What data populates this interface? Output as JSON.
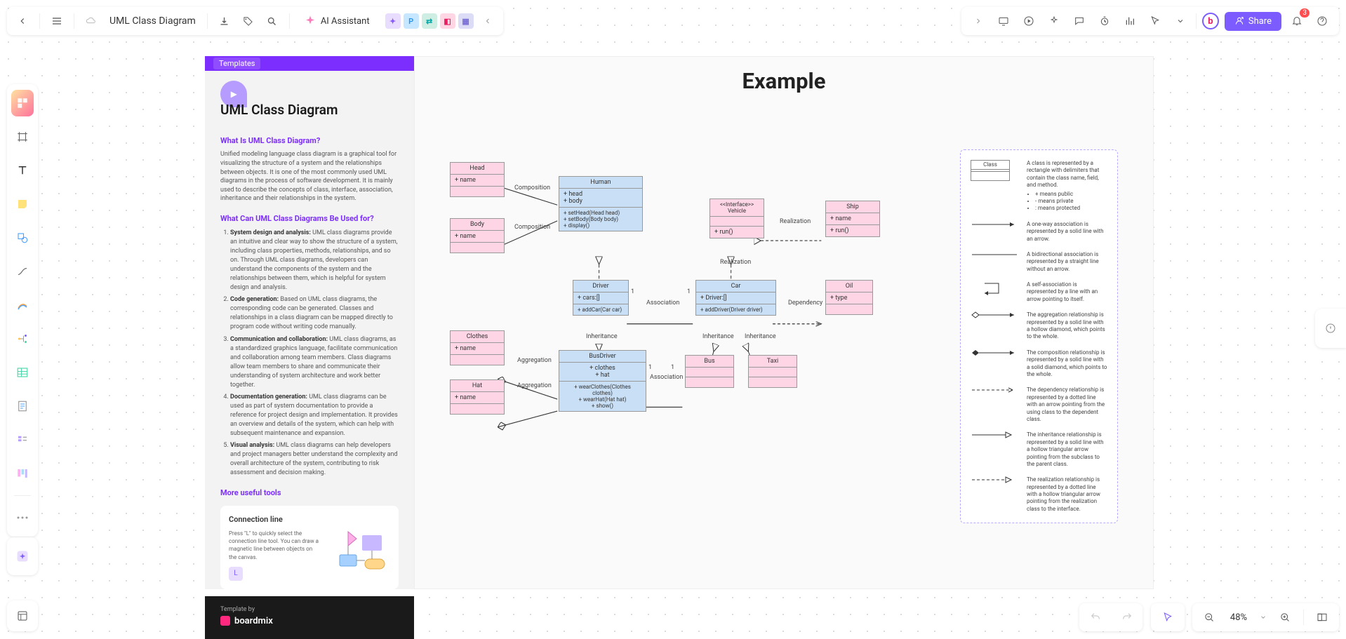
{
  "doc_title": "UML Class Diagram",
  "ai_label": "AI Assistant",
  "share_label": "Share",
  "notif_count": "3",
  "zoom": "48%",
  "templates_tab": "Templates",
  "panel": {
    "title": "UML Class Diagram",
    "q1": "What Is UML Class Diagram?",
    "p1": "Unified modeling language class diagram is a graphical tool for visualizing the structure of a system and the relationships between objects. It is one of the most commonly used UML diagrams in the process of software development. It is mainly used to describe the concepts of class, interface, association, inheritance and their relationships in the system.",
    "q2": "What Can UML Class Diagrams Be Used for?",
    "li1b": "System design and analysis:",
    "li1": " UML class diagrams provide an intuitive and clear way to show the structure of a system, including class properties, methods, relationships, and so on. Through UML class diagrams, developers can understand the components of the system and the relationships between them, which is helpful for system design and analysis.",
    "li2b": "Code generation:",
    "li2": " Based on UML class diagrams, the corresponding code can be generated. Classes and relationships in a class diagram can be mapped directly to program code without writing code manually.",
    "li3b": "Communication and collaboration:",
    "li3": " UML class diagrams, as a standardized graphics language, facilitate communication and collaboration among team members. Class diagrams allow team members to share and communicate their understanding of system architecture and work better together.",
    "li4b": "Documentation generation:",
    "li4": " UML class diagrams can be used as part of system documentation to provide a reference for project design and implementation. It provides an overview and details of the system, which can help with subsequent maintenance and expansion.",
    "li5b": "Visual analysis:",
    "li5": " UML class diagrams can help developers and project managers better understand the complexity and overall architecture of the system, contributing to risk assessment and decision making.",
    "tools_h": "More useful tools",
    "tip_title": "Connection line",
    "tip_text": "Press \"L\" to quickly select the connection line tool. You can draw a magnetic line between objects on the canvas.",
    "tip_key": "L",
    "tmpl_by": "Template by",
    "brand": "boardmix"
  },
  "example_title": "Example",
  "classes": {
    "head": {
      "name": "Head",
      "attrs": "+ name"
    },
    "body": {
      "name": "Body",
      "attrs": "+ name"
    },
    "human": {
      "name": "Human",
      "attrs": "+ head\n+ body",
      "ops": "+ setHead(Head head)\n+ setBody(Body body)\n+ display()"
    },
    "vehicle": {
      "name": "<<Interface>>\nVehicle",
      "ops": "+ run()"
    },
    "ship": {
      "name": "Ship",
      "attrs": "+ name",
      "ops": "+ run()"
    },
    "driver": {
      "name": "Driver",
      "attrs": "+ cars:[]",
      "ops": "+ addCar(Car car)"
    },
    "car": {
      "name": "Car",
      "attrs": "+ Driver:[]",
      "ops": "+ addDriver(Driver driver)"
    },
    "oil": {
      "name": "Oil",
      "attrs": "+ type"
    },
    "clothes": {
      "name": "Clothes",
      "attrs": "+ name"
    },
    "hat": {
      "name": "Hat",
      "attrs": "+ name"
    },
    "busdriver": {
      "name": "BusDriver",
      "attrs": "+ clothes\n+ hat",
      "ops": "+ wearClothes(Clothes clothes)\n+ wearHat(Hat hat)\n+ show()"
    },
    "bus": {
      "name": "Bus"
    },
    "taxi": {
      "name": "Taxi"
    }
  },
  "labels": {
    "comp1": "Composition",
    "comp2": "Composition",
    "real1": "Realization",
    "real2": "Realization",
    "assoc1": "Association",
    "assoc2": "Association",
    "dep": "Dependency",
    "agg1": "Aggregation",
    "agg2": "Aggregation",
    "inh1": "Inheritance",
    "inh2": "Inheritance",
    "inh3": "Inheritance",
    "one_a": "1",
    "one_b": "1",
    "one_c": "1",
    "one_d": "1"
  },
  "legend": {
    "cls_label": "Class",
    "l1": "A class is represented by a rectangle with delimiters that contain the class name, field, and method.",
    "l1a": "+ means public",
    "l1b": "- means private",
    "l1c": ": means protected",
    "l2": "A one-way association is represented by a solid line with an arrow.",
    "l3": "A bidirectional association is represented by a straight line without an arrow.",
    "l4": "A self-association is represented by a line with an arrow pointing to itself.",
    "l5": "The aggregation relationship is represented by a solid line with a hollow diamond, which points to the whole.",
    "l6": "The composition relationship is represented by a solid line with a solid diamond, which points to the whole.",
    "l7": "The dependency relationship is represented by a dotted line with an arrow pointing from the using class to the dependent class.",
    "l8": "The inheritance relationship is represented by a solid line with a hollow triangular arrow pointing from the subclass to the parent class.",
    "l9": "The realization relationship is represented by a dotted line with a hollow triangular arrow pointing from the realization class to the interface."
  }
}
